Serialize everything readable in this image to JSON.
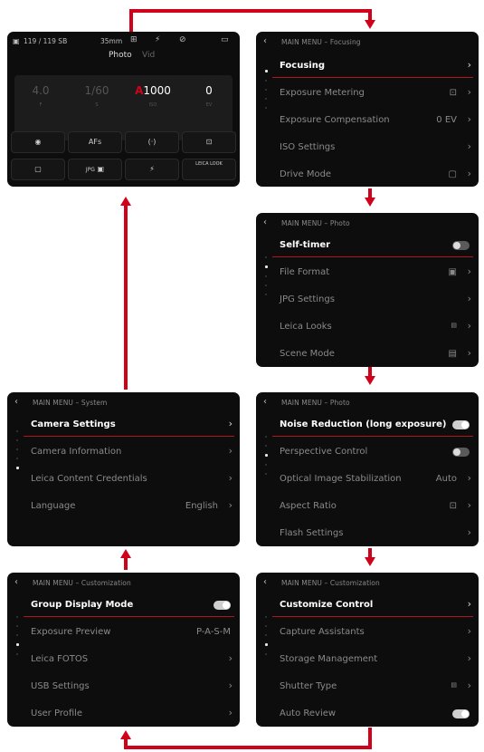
{
  "liveview": {
    "status_left": "119 / 119 SB",
    "focal": "35mm",
    "mode_photo": "Photo",
    "mode_video": "Vid",
    "exposure": [
      {
        "value": "4.0",
        "sub": "F"
      },
      {
        "value": "1/60",
        "sub": "S"
      },
      {
        "value_prefix": "A",
        "value": "1000",
        "sub": "ISO"
      },
      {
        "value": "0",
        "sub": "EV"
      }
    ],
    "grid_afs": "AFs",
    "grid_format": "JPG",
    "grid_look": "LEICA LOOK"
  },
  "screens": {
    "focusing": {
      "title": "MAIN MENU – Focusing",
      "items": [
        {
          "label": "Focusing"
        },
        {
          "label": "Exposure Metering"
        },
        {
          "label": "Exposure Compensation",
          "value": "0 EV"
        },
        {
          "label": "ISO Settings"
        },
        {
          "label": "Drive Mode"
        }
      ]
    },
    "photo1": {
      "title": "MAIN MENU – Photo",
      "items": [
        {
          "label": "Self-timer"
        },
        {
          "label": "File Format"
        },
        {
          "label": "JPG Settings"
        },
        {
          "label": "Leica Looks"
        },
        {
          "label": "Scene Mode"
        }
      ]
    },
    "photo2": {
      "title": "MAIN MENU – Photo",
      "items": [
        {
          "label": "Noise Reduction (long exposure)"
        },
        {
          "label": "Perspective Control"
        },
        {
          "label": "Optical Image Stabilization",
          "value": "Auto"
        },
        {
          "label": "Aspect Ratio"
        },
        {
          "label": "Flash Settings"
        }
      ]
    },
    "custom1": {
      "title": "MAIN MENU – Customization",
      "items": [
        {
          "label": "Customize Control"
        },
        {
          "label": "Capture Assistants"
        },
        {
          "label": "Storage Management"
        },
        {
          "label": "Shutter Type"
        },
        {
          "label": "Auto Review"
        }
      ]
    },
    "custom2": {
      "title": "MAIN MENU – Customization",
      "items": [
        {
          "label": "Group Display Mode"
        },
        {
          "label": "Exposure Preview",
          "value": "P-A-S-M"
        },
        {
          "label": "Leica FOTOS"
        },
        {
          "label": "USB Settings"
        },
        {
          "label": "User Profile"
        }
      ]
    },
    "system": {
      "title": "MAIN MENU – System",
      "items": [
        {
          "label": "Camera Settings"
        },
        {
          "label": "Camera Information"
        },
        {
          "label": "Leica Content Credentials"
        },
        {
          "label": "Language",
          "value": "English"
        }
      ]
    }
  },
  "colors": {
    "accent": "#d0021b",
    "screen_bg": "#0d0d0d"
  }
}
